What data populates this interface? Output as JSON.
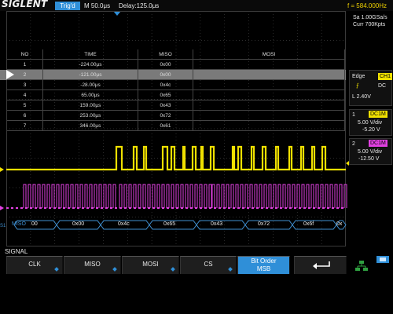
{
  "header": {
    "logo": "SIGLENT",
    "trigger_status": "Trig'd",
    "timebase": "M 50.0μs",
    "delay": "Delay:125.0μs",
    "frequency": "f = 584.000Hz"
  },
  "decode_table": {
    "columns": [
      "NO",
      "TIME",
      "MISO",
      "MOSI"
    ],
    "selected_row": 2,
    "rows": [
      {
        "no": "1",
        "time": "-224.00μs",
        "miso": "0x00",
        "mosi": ""
      },
      {
        "no": "2",
        "time": "-121.00μs",
        "miso": "0x00",
        "mosi": ""
      },
      {
        "no": "3",
        "time": "-28.00μs",
        "miso": "0x4c",
        "mosi": ""
      },
      {
        "no": "4",
        "time": "65.00μs",
        "miso": "0x65",
        "mosi": ""
      },
      {
        "no": "5",
        "time": "159.00μs",
        "miso": "0x43",
        "mosi": ""
      },
      {
        "no": "6",
        "time": "253.00μs",
        "miso": "0x72",
        "mosi": ""
      },
      {
        "no": "7",
        "time": "346.00μs",
        "miso": "0x61",
        "mosi": ""
      }
    ]
  },
  "right_panel": {
    "sample_rate": "Sa 1.00GSa/s",
    "curr_points": "Curr 700Kpts",
    "trigger_type": "Edge",
    "trigger_source": "CH1",
    "trigger_coupling": "DC",
    "trigger_level": "L  2.40V",
    "ch1": {
      "num": "1",
      "coupling": "DC1M",
      "vdiv": "5.00 V/div",
      "offset": "-5.20 V"
    },
    "ch2": {
      "num": "2",
      "coupling": "DC1M",
      "vdiv": "5.00 V/div",
      "offset": "-12.50 V"
    }
  },
  "bus": {
    "label": "MISO",
    "values": [
      "00",
      "0x00",
      "0x4c",
      "0x65",
      "0x43",
      "0x72",
      "0x6f",
      "0x"
    ]
  },
  "softkeys": {
    "menu_title": "SIGNAL",
    "clk": "CLK",
    "miso": "MISO",
    "mosi": "MOSI",
    "cs": "CS",
    "bit_order_line1": "Bit Order",
    "bit_order_line2": "MSB"
  },
  "colors": {
    "ch1": "#f0e000",
    "ch2": "#e040e0",
    "bus": "#3f8fd0",
    "accent": "#2f8fd8"
  }
}
